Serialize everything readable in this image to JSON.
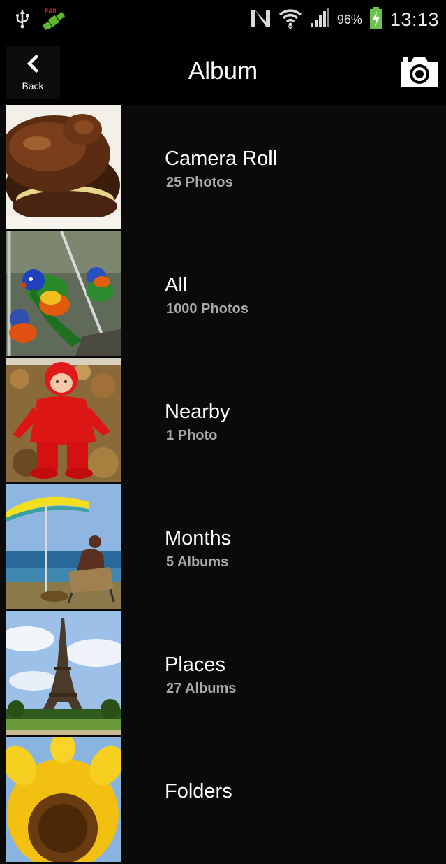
{
  "status_bar": {
    "battery_percent": "96%",
    "time": "13:13",
    "icons": [
      "usb-icon",
      "gps-icon",
      "nfc-icon",
      "wifi-icon",
      "signal-icon",
      "battery-charging-icon"
    ]
  },
  "header": {
    "back_label": "Back",
    "title": "Album",
    "camera_icon": "camera-icon"
  },
  "albums": [
    {
      "name": "Camera Roll",
      "count": "25 Photos"
    },
    {
      "name": "All",
      "count": "1000 Photos"
    },
    {
      "name": "Nearby",
      "count": "1 Photo"
    },
    {
      "name": "Months",
      "count": "5 Albums"
    },
    {
      "name": "Places",
      "count": "27 Albums"
    },
    {
      "name": "Folders",
      "count": ""
    }
  ],
  "colors": {
    "background": "#0a0a0a",
    "text_primary": "#ffffff",
    "text_secondary": "#a9a9a9",
    "battery_green": "#6cc24a"
  }
}
